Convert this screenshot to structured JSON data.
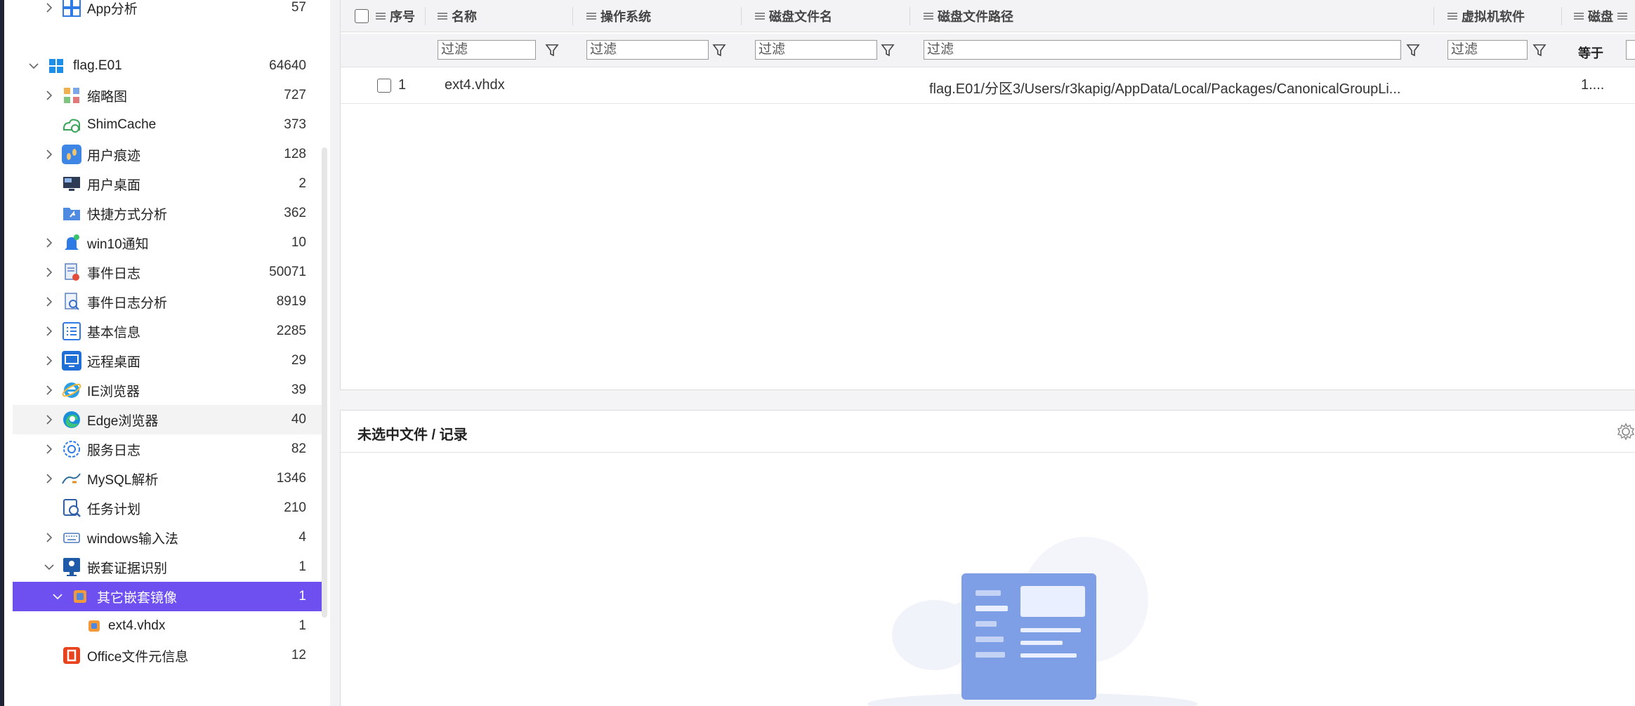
{
  "sidebar": {
    "items": [
      {
        "label": "App分析",
        "count": "57",
        "icon": "windows-icon",
        "expand": "collapsed"
      },
      {
        "label": "flag.E01",
        "count": "64640",
        "icon": "windows-logo-icon",
        "expand": "expanded"
      },
      {
        "label": "缩略图",
        "count": "727",
        "icon": "thumbnail-icon",
        "expand": "collapsed"
      },
      {
        "label": "ShimCache",
        "count": "373",
        "icon": "shimcache-icon",
        "expand": "none"
      },
      {
        "label": "用户痕迹",
        "count": "128",
        "icon": "footprints-icon",
        "expand": "collapsed"
      },
      {
        "label": "用户桌面",
        "count": "2",
        "icon": "desktop-icon",
        "expand": "none"
      },
      {
        "label": "快捷方式分析",
        "count": "362",
        "icon": "shortcut-folder-icon",
        "expand": "none"
      },
      {
        "label": "win10通知",
        "count": "10",
        "icon": "bell-icon",
        "expand": "collapsed"
      },
      {
        "label": "事件日志",
        "count": "50071",
        "icon": "event-log-icon",
        "expand": "collapsed"
      },
      {
        "label": "事件日志分析",
        "count": "8919",
        "icon": "event-log-analysis-icon",
        "expand": "collapsed"
      },
      {
        "label": "基本信息",
        "count": "2285",
        "icon": "list-icon",
        "expand": "collapsed"
      },
      {
        "label": "远程桌面",
        "count": "29",
        "icon": "remote-desktop-icon",
        "expand": "collapsed"
      },
      {
        "label": "IE浏览器",
        "count": "39",
        "icon": "ie-icon",
        "expand": "collapsed"
      },
      {
        "label": "Edge浏览器",
        "count": "40",
        "icon": "edge-icon",
        "expand": "collapsed"
      },
      {
        "label": "服务日志",
        "count": "82",
        "icon": "service-icon",
        "expand": "collapsed"
      },
      {
        "label": "MySQL解析",
        "count": "1346",
        "icon": "mysql-icon",
        "expand": "collapsed"
      },
      {
        "label": "任务计划",
        "count": "210",
        "icon": "task-schedule-icon",
        "expand": "none"
      },
      {
        "label": "windows输入法",
        "count": "4",
        "icon": "keyboard-icon",
        "expand": "collapsed"
      },
      {
        "label": "嵌套证据识别",
        "count": "1",
        "icon": "nested-evidence-icon",
        "expand": "expanded"
      },
      {
        "label": "其它嵌套镜像",
        "count": "1",
        "icon": "disk-image-icon",
        "expand": "expanded"
      },
      {
        "label": "ext4.vhdx",
        "count": "1",
        "icon": "vhdx-file-icon",
        "expand": "none"
      },
      {
        "label": "Office文件元信息",
        "count": "12",
        "icon": "office-icon",
        "expand": "none"
      }
    ]
  },
  "table": {
    "columns": [
      "序号",
      "名称",
      "操作系统",
      "磁盘文件名",
      "磁盘文件路径",
      "虚拟机软件",
      "磁盘"
    ],
    "filter_placeholder": "过滤",
    "equals_label": "等于",
    "rows": [
      {
        "index": "1",
        "name": "ext4.vhdx",
        "os": "",
        "disk_file_name": "",
        "disk_file_path": "flag.E01/分区3/Users/r3kapig/AppData/Local/Packages/CanonicalGroupLi...",
        "vm_software": "",
        "disk_extra": "1...."
      }
    ]
  },
  "detail": {
    "title": "未选中文件 / 记录"
  },
  "colors": {
    "selected": "#6e4ff0",
    "header_bg": "#f3f3f5",
    "accent_blue": "#3b7de0"
  }
}
